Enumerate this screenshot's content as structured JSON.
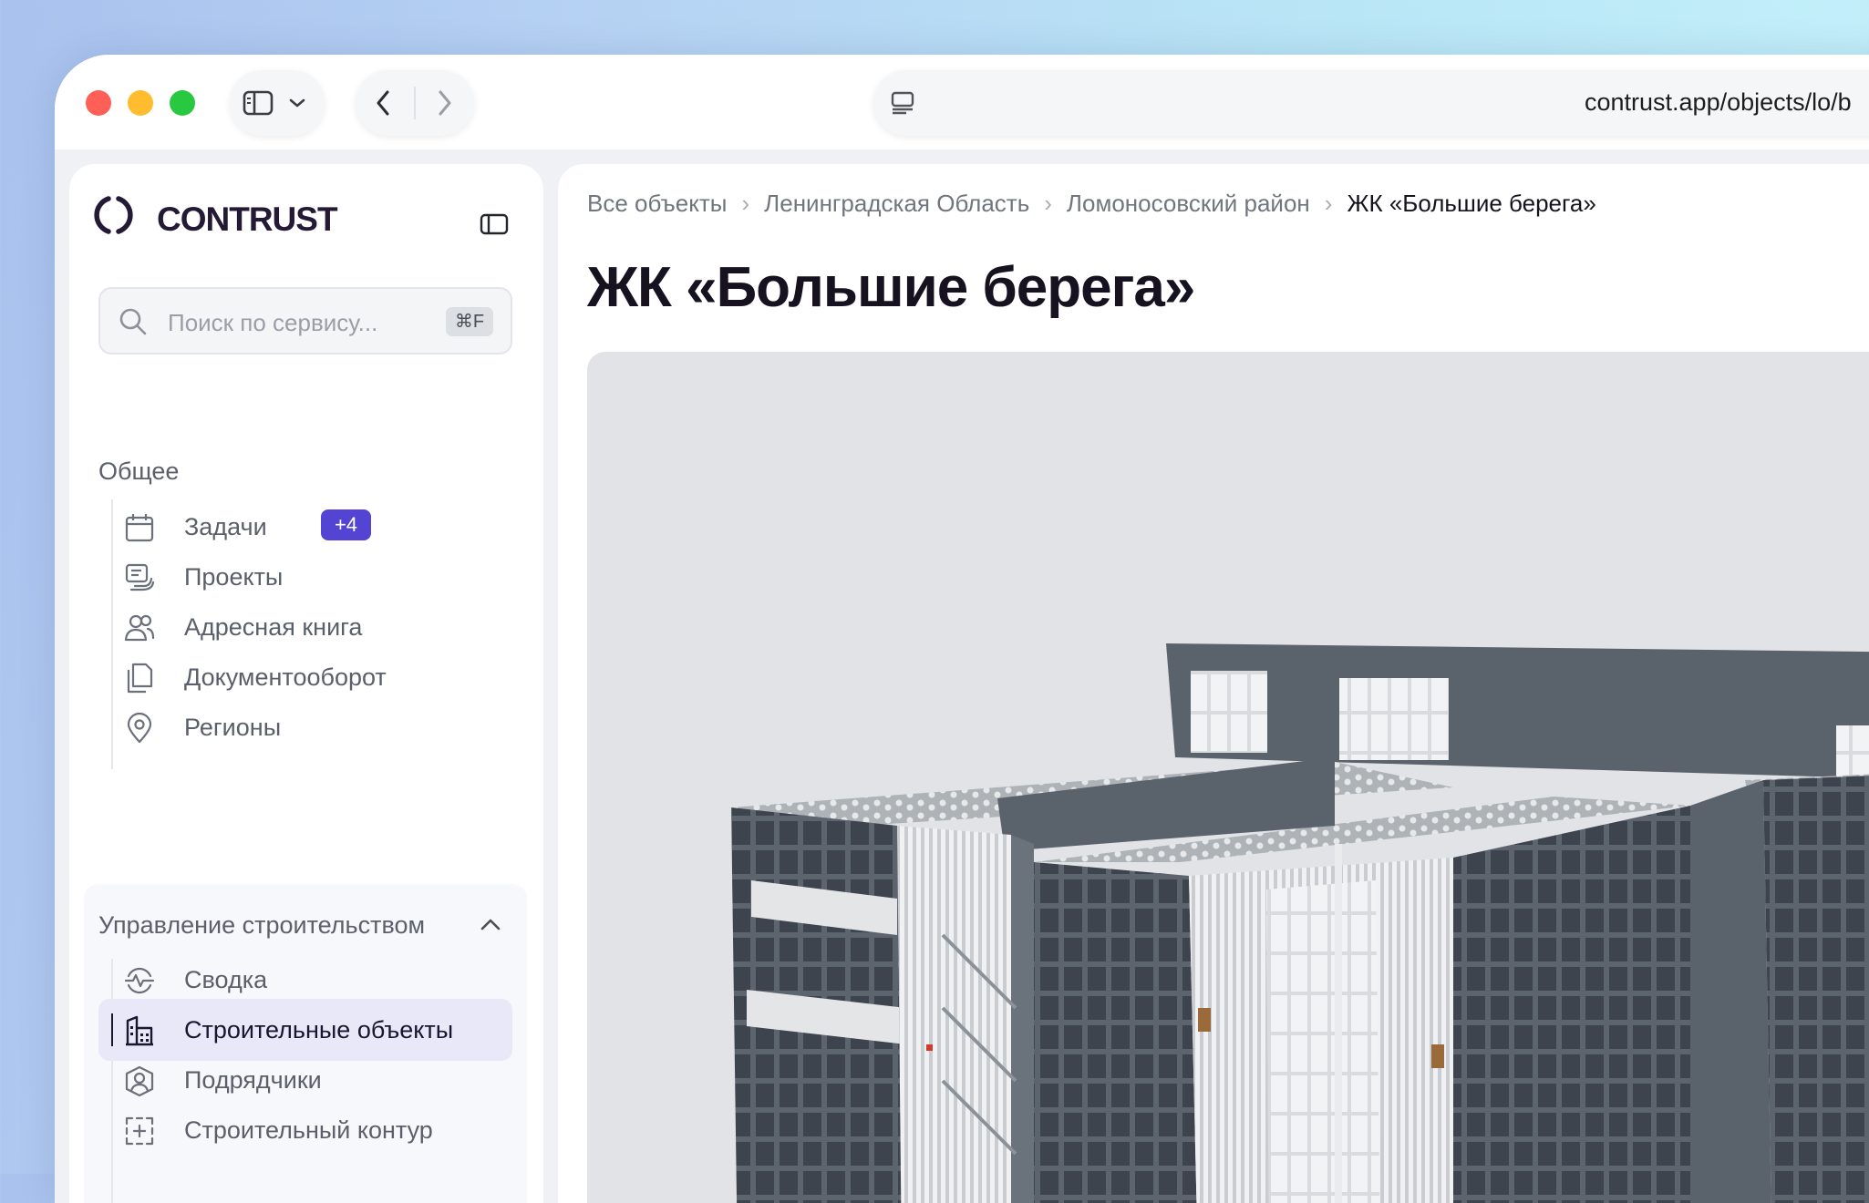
{
  "browser": {
    "url": "contrust.app/objects/lo/b"
  },
  "sidebar": {
    "logo_text": "CONTRUST",
    "search": {
      "placeholder": "Поиск по сервису...",
      "shortcut": "⌘F"
    },
    "general": {
      "label": "Общее",
      "items": [
        {
          "label": "Задачи",
          "icon": "calendar-icon",
          "badge": "+4"
        },
        {
          "label": "Проекты",
          "icon": "projects-icon"
        },
        {
          "label": "Адресная книга",
          "icon": "users-icon"
        },
        {
          "label": "Документооборот",
          "icon": "documents-icon"
        },
        {
          "label": "Регионы",
          "icon": "location-pin-icon"
        }
      ]
    },
    "construction": {
      "label": "Управление строительством",
      "items": [
        {
          "label": "Сводка",
          "icon": "pulse-icon"
        },
        {
          "label": "Строительные объекты",
          "icon": "building-icon",
          "active": true
        },
        {
          "label": "Подрядчики",
          "icon": "contractor-icon"
        },
        {
          "label": "Строительный контур",
          "icon": "contour-icon"
        }
      ]
    }
  },
  "content": {
    "breadcrumbs": [
      "Все объекты",
      "Ленинградская Область",
      "Ломоносовский район",
      "ЖК «Большие берега»"
    ],
    "title": "ЖК «Большие берега»"
  },
  "colors": {
    "accent": "#5344d4",
    "brand_dark": "#241a36",
    "active_bg": "#e9e8f9"
  }
}
